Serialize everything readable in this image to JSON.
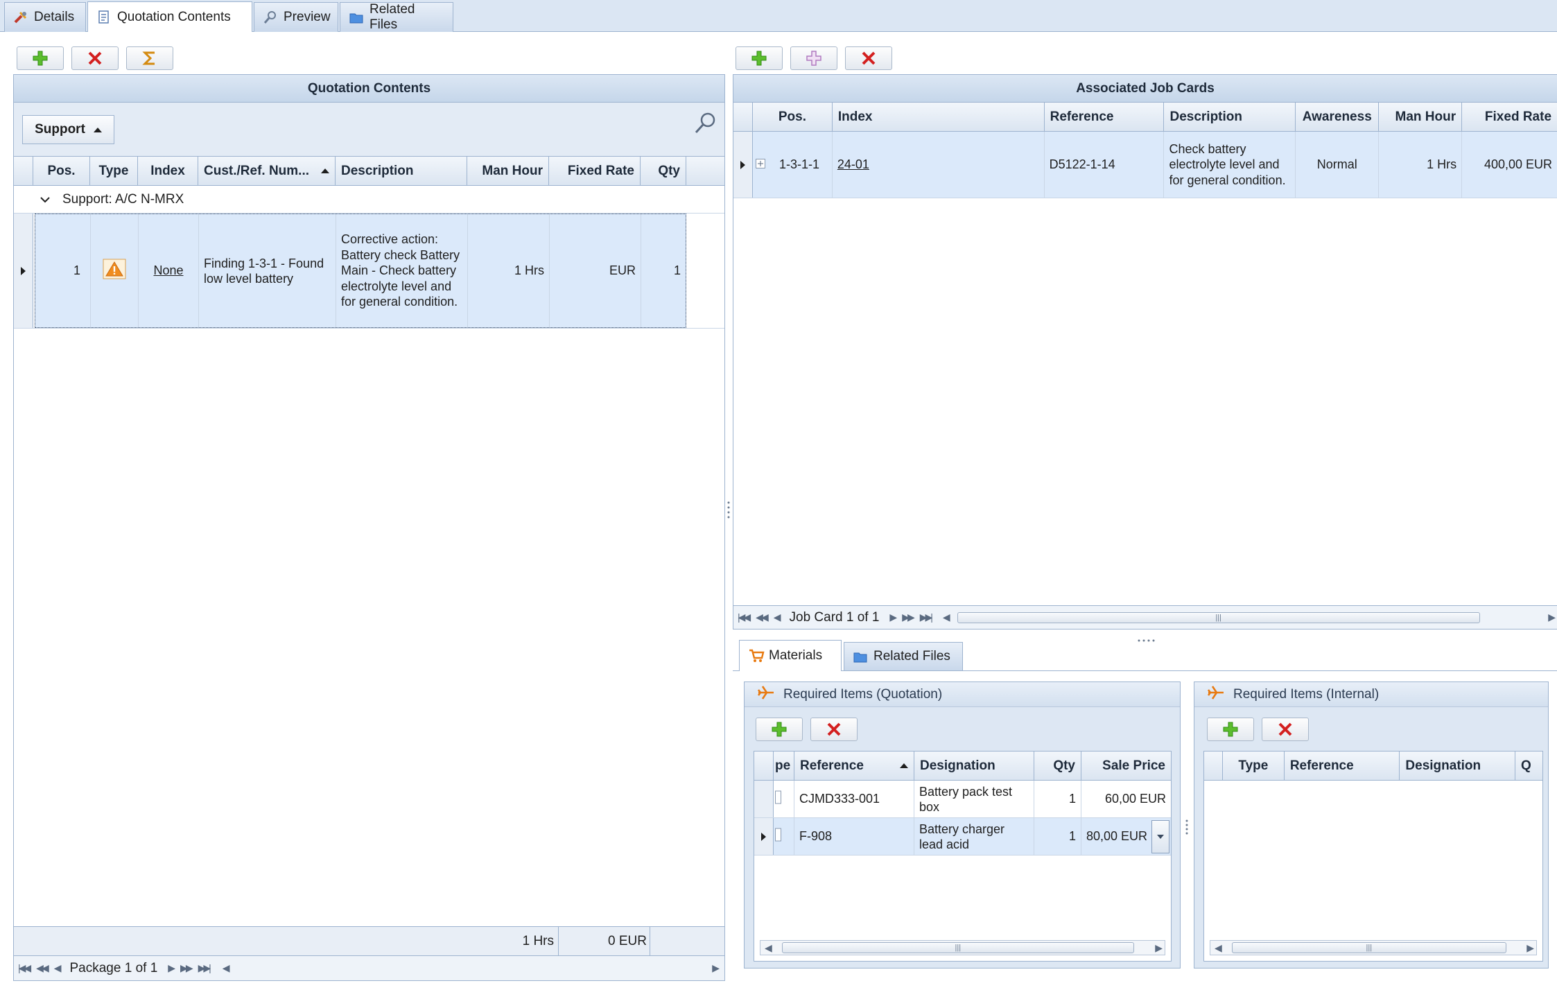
{
  "tabs": [
    {
      "label": "Details",
      "icon": "tools-icon"
    },
    {
      "label": "Quotation Contents",
      "icon": "document-icon"
    },
    {
      "label": "Preview",
      "icon": "magnifier-icon"
    },
    {
      "label": "Related Files",
      "icon": "folder-icon"
    }
  ],
  "quotation": {
    "title": "Quotation Contents",
    "group_button": "Support",
    "columns": [
      "Pos.",
      "Type",
      "Index",
      "Cust./Ref. Num...",
      "Description",
      "Man Hour",
      "Fixed Rate",
      "Qty"
    ],
    "group_row": "Support: A/C N-MRX",
    "rows": [
      {
        "pos": "1",
        "type": "warning-icon",
        "index": "None",
        "cust_ref": "Finding 1-3-1 - Found low level battery",
        "description": "Corrective action: Battery check Battery Main - Check battery electrolyte level and for general condition.",
        "man_hour": "1 Hrs",
        "fixed_rate": "EUR",
        "qty": "1"
      }
    ],
    "footer_man_hour": "1 Hrs",
    "footer_fixed_rate": "0 EUR",
    "nav_label": "Package 1 of 1"
  },
  "job_cards": {
    "title": "Associated Job Cards",
    "columns": [
      "Pos.",
      "Index",
      "Reference",
      "Description",
      "Awareness",
      "Man Hour",
      "Fixed Rate"
    ],
    "rows": [
      {
        "pos": "1-3-1-1",
        "index": "24-01",
        "reference": "D5122-1-14",
        "description": "Check battery electrolyte level and for general condition.",
        "awareness": "Normal",
        "man_hour": "1 Hrs",
        "fixed_rate": "400,00 EUR"
      }
    ],
    "nav_label": "Job Card 1 of 1"
  },
  "sub_tabs": [
    {
      "label": "Materials",
      "icon": "cart-icon"
    },
    {
      "label": "Related Files",
      "icon": "folder-icon"
    }
  ],
  "required_quotation": {
    "title": "Required Items (Quotation)",
    "columns": [
      "pe",
      "Reference",
      "Designation",
      "Qty",
      "Sale Price"
    ],
    "rows": [
      {
        "reference": "CJMD333-001",
        "designation": "Battery pack test box",
        "qty": "1",
        "sale_price": "60,00 EUR"
      },
      {
        "reference": "F-908",
        "designation": "Battery charger lead acid",
        "qty": "1",
        "sale_price": "80,00 EUR"
      }
    ]
  },
  "required_internal": {
    "title": "Required Items (Internal)",
    "columns": [
      "Type",
      "Reference",
      "Designation",
      "Q"
    ]
  },
  "colors": {
    "accent_border": "#9db3cf",
    "header_bg": "#c5d6ea",
    "selected_row": "#dbe9fa",
    "add_green": "#4caf28",
    "delete_red": "#d32020",
    "warning_orange": "#f08c1e"
  }
}
